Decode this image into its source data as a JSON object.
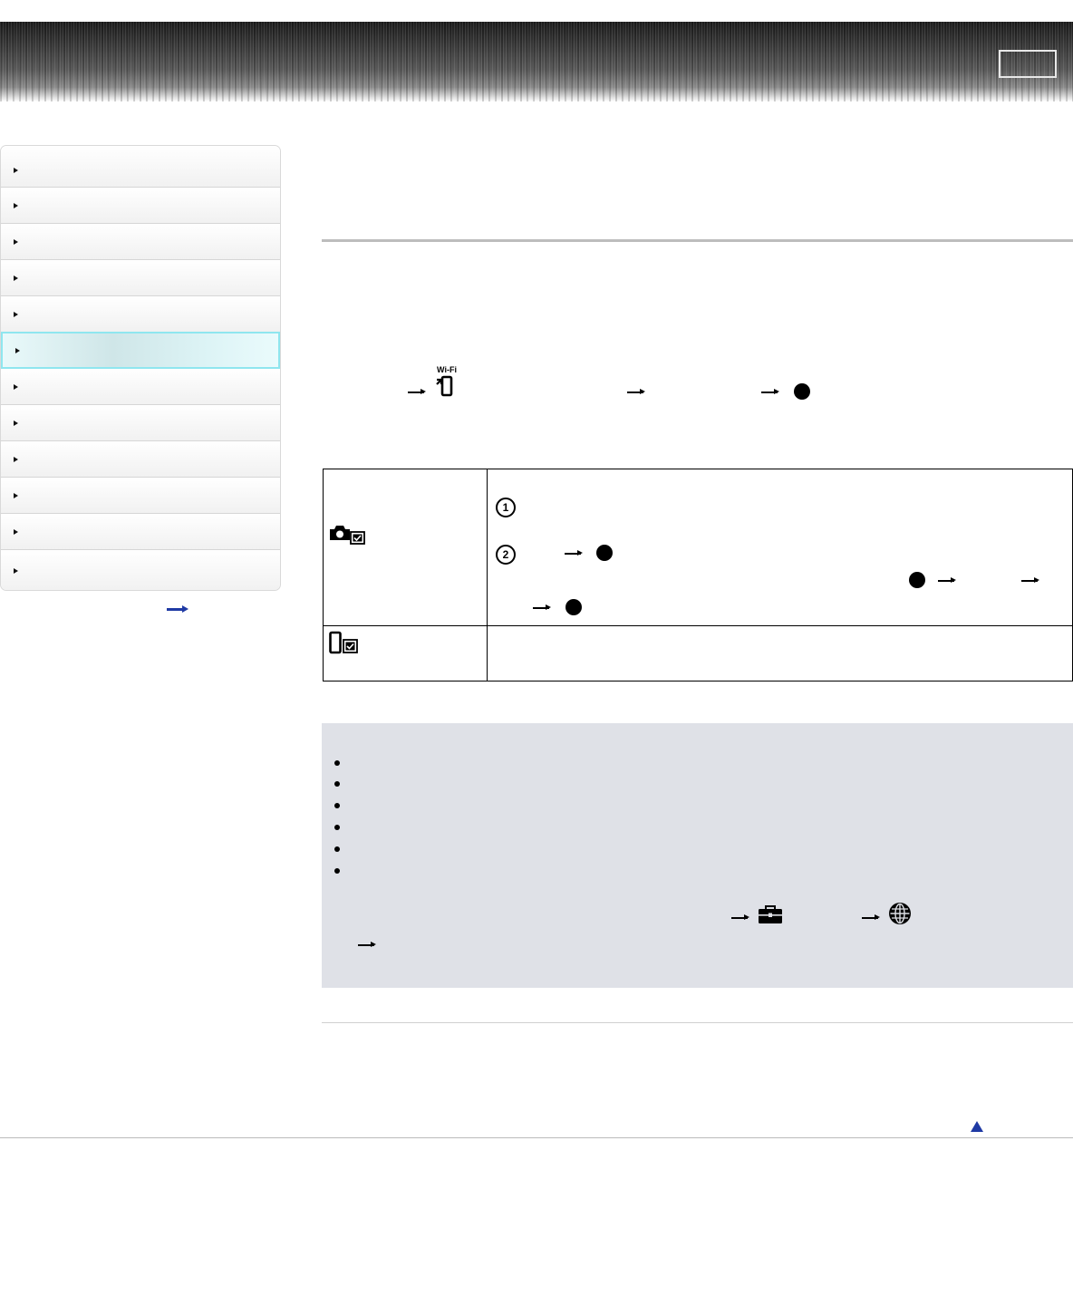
{
  "header": {
    "button_label": ""
  },
  "sidebar": {
    "items": [
      {
        "label": ""
      },
      {
        "label": ""
      },
      {
        "label": ""
      },
      {
        "label": ""
      },
      {
        "label": ""
      },
      {
        "label": ""
      },
      {
        "label": ""
      },
      {
        "label": ""
      },
      {
        "label": ""
      },
      {
        "label": ""
      },
      {
        "label": ""
      },
      {
        "label": ""
      }
    ],
    "active_index": 5,
    "more_link_label": ""
  },
  "main": {
    "wifi_icon_text": "Wi-Fi",
    "step_numbers": [
      "1",
      "2"
    ]
  },
  "icons": {
    "header_button": "header-button",
    "sidebar_bullet": "triangle-right-icon",
    "more_link": "arrow-right-icon",
    "menu_path_arrow": "arrow-right-icon",
    "wifi": "wifi-send-icon",
    "option_camera": "camera-check-icon",
    "option_smartphone": "smartphone-check-icon",
    "setup": "toolbox-icon",
    "network": "globe-icon",
    "page_top": "up-triangle-icon"
  },
  "colors": {
    "sidebar_active_border": "#8fe6ef",
    "notes_background": "#dfe1e7",
    "link_blue": "#1f3aa4"
  }
}
